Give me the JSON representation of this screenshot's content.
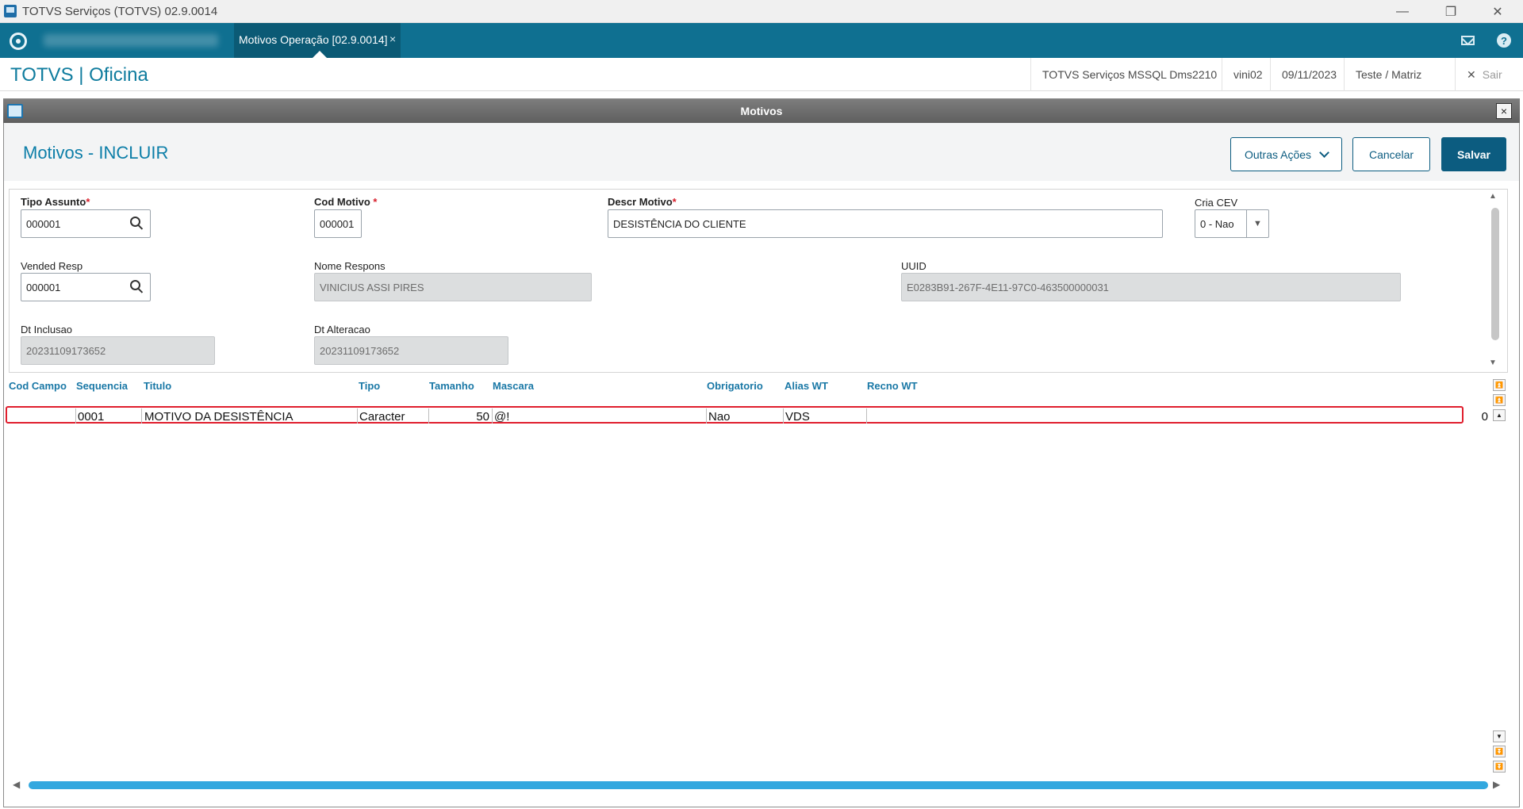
{
  "window": {
    "title": "TOTVS Serviços (TOTVS) 02.9.0014",
    "controls": {
      "minimize": "—",
      "restore": "❐",
      "close": "✕"
    }
  },
  "tabbar": {
    "active_tab": {
      "label": "Motivos Operação [02.9.0014]",
      "close": "×"
    },
    "icons": [
      "totvs-logo-icon",
      "mail-icon",
      "help-icon"
    ],
    "help_glyph": "?"
  },
  "header": {
    "brand": "TOTVS | Oficina",
    "environment": "TOTVS Serviços MSSQL Dms2210",
    "user": "vini02",
    "date": "09/11/2023",
    "branch": "Teste / Matriz",
    "exit_label": "Sair",
    "exit_glyph": "✕"
  },
  "dialog": {
    "title": "Motivos",
    "close_glyph": "×"
  },
  "page": {
    "title": "Motivos - INCLUIR",
    "buttons": {
      "other_actions": "Outras Ações",
      "cancel": "Cancelar",
      "save": "Salvar"
    }
  },
  "form": {
    "tipo_assunto": {
      "label": "Tipo Assunto",
      "required": "*",
      "value": "000001"
    },
    "cod_motivo": {
      "label": "Cod Motivo ",
      "required": "*",
      "value": "000001"
    },
    "descr_motivo": {
      "label": "Descr Motivo",
      "required": "*",
      "value": "DESISTÊNCIA DO CLIENTE"
    },
    "cria_cev": {
      "label": "Cria CEV",
      "value": "0 - Nao",
      "arrow": "▼"
    },
    "vended_resp": {
      "label": "Vended Resp",
      "value": "000001"
    },
    "nome_respons": {
      "label": "Nome Respons",
      "value": "VINICIUS ASSI PIRES"
    },
    "uuid": {
      "label": "UUID",
      "value": "E0283B91-267F-4E11-97C0-463500000031"
    },
    "dt_inclusao": {
      "label": "Dt Inclusao",
      "value": "20231109173652"
    },
    "dt_alteracao": {
      "label": "Dt Alteracao",
      "value": "20231109173652"
    }
  },
  "grid": {
    "columns": [
      "Cod Campo",
      "Sequencia",
      "Titulo",
      "Tipo",
      "Tamanho",
      "Mascara",
      "Obrigatorio",
      "Alias WT",
      "Recno WT"
    ],
    "rows": [
      {
        "cod_campo": "",
        "sequencia": "0001",
        "titulo": "MOTIVO DA DESISTÊNCIA",
        "tipo": "Caracter",
        "tamanho": "50",
        "mascara": "@!",
        "obrigatorio": "Nao",
        "alias_wt": "VDS",
        "recno_wt": "0"
      }
    ],
    "nav": {
      "first": "⏫",
      "prev_page": "⏫",
      "up": "▲",
      "down": "▼",
      "next_page": "⏬",
      "last": "⏬"
    }
  },
  "scroll": {
    "up": "▲",
    "down": "▼",
    "left": "◀",
    "right": "▶"
  }
}
